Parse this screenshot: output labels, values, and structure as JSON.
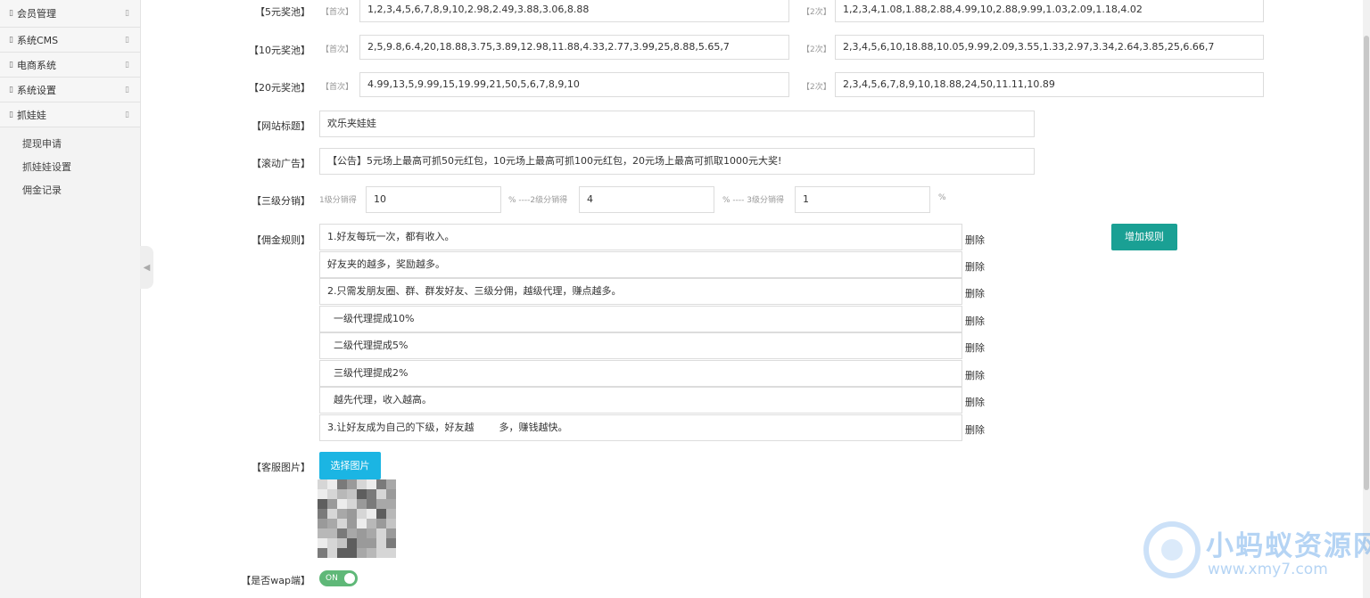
{
  "sidebar": {
    "menu": [
      {
        "label": "会员管理"
      },
      {
        "label": "系统CMS"
      },
      {
        "label": "电商系统"
      },
      {
        "label": "系统设置"
      },
      {
        "label": "抓娃娃"
      }
    ],
    "submenu": [
      {
        "label": "提现申请"
      },
      {
        "label": "抓娃娃设置"
      },
      {
        "label": "佣金记录"
      }
    ]
  },
  "form": {
    "pools": [
      {
        "label": "【5元奖池】",
        "first_tag": "【首次】",
        "first_value": "1,2,3,4,5,6,7,8,9,10,2.98,2.49,3.88,3.06,8.88",
        "second_tag": "【2次】",
        "second_value": "1,2,3,4,1.08,1.88,2.88,4.99,10,2.88,9.99,1.03,2.09,1.18,4.02"
      },
      {
        "label": "【10元奖池】",
        "first_tag": "【首次】",
        "first_value": "2,5,9.8,6.4,20,18.88,3.75,3.89,12.98,11.88,4.33,2.77,3.99,25,8.88,5.65,7",
        "second_tag": "【2次】",
        "second_value": "2,3,4,5,6,10,18.88,10.05,9.99,2.09,3.55,1.33,2.97,3.34,2.64,3.85,25,6.66,7"
      },
      {
        "label": "【20元奖池】",
        "first_tag": "【首次】",
        "first_value": "4.99,13,5,9.99,15,19.99,21,50,5,6,7,8,9,10",
        "second_tag": "【2次】",
        "second_value": "2,3,4,5,6,7,8,9,10,18.88,24,50,11.11,10.89"
      }
    ],
    "site_title": {
      "label": "【网站标题】",
      "value": "欢乐夹娃娃"
    },
    "scroll_ad": {
      "label": "【滚动广告】",
      "value": "【公告】5元场上最高可抓50元红包，10元场上最高可抓100元红包，20元场上最高可抓取1000元大奖!"
    },
    "distribution": {
      "label": "【三级分销】",
      "level1_hint": "1级分销得",
      "level1_value": "10",
      "level2_hint": "% ----2级分销得",
      "level2_value": "4",
      "level3_hint": "% ---- 3级分销得",
      "level3_value": "1",
      "percent": "%"
    },
    "commission": {
      "label": "【佣金规则】",
      "add_button": "增加规则",
      "delete_label": "删除",
      "rules": [
        "1.好友每玩一次，都有收入。",
        "好友夹的越多，奖励越多。",
        "2.只需发朋友圈、群、群发好友、三级分佣，越级代理，赚点越多。",
        "  一级代理提成10%",
        "  二级代理提成5%",
        "  三级代理提成2%",
        "  越先代理，收入越高。",
        "3.让好友成为自己的下级，好友越        多，赚钱越快。"
      ]
    },
    "service_image": {
      "label": "【客服图片】",
      "button": "选择图片"
    },
    "wap": {
      "label": "【是否wap端】",
      "toggle_text": "ON",
      "enabled": true
    }
  },
  "watermark": {
    "title": "小蚂蚁资源网",
    "url": "www.xmy7.com"
  },
  "colors": {
    "teal": "#1aa094",
    "blue": "#1bb5e3",
    "green": "#5fb878"
  }
}
